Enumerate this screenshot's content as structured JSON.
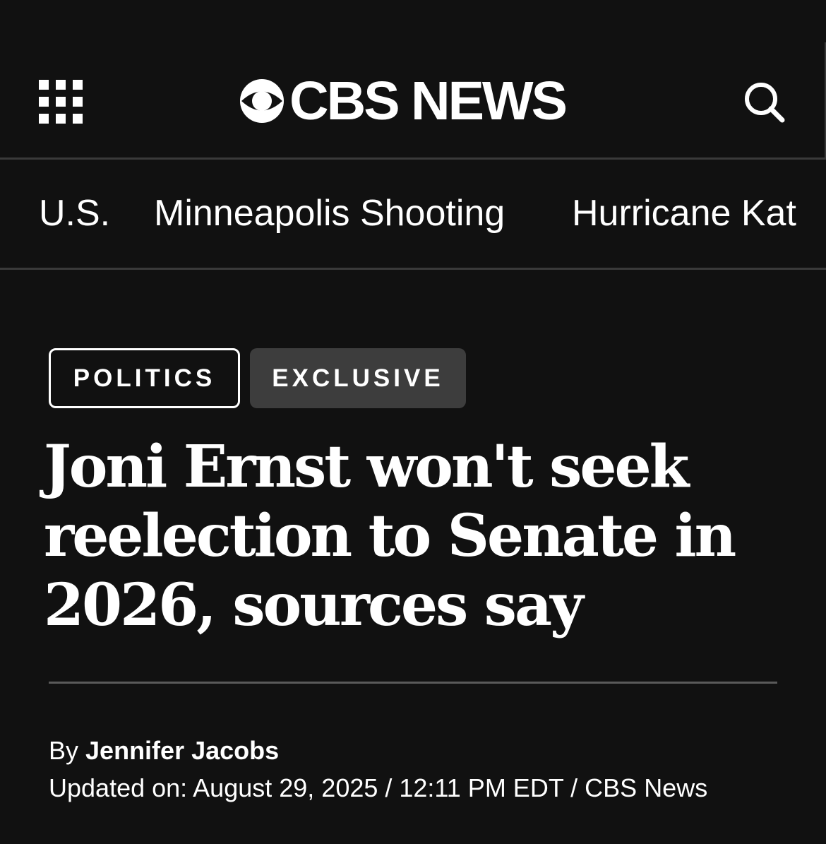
{
  "header": {
    "logo_text": "CBS NEWS",
    "menu_icon": "grid-menu-icon",
    "logo_icon": "cbs-eye-icon",
    "search_icon": "search-icon"
  },
  "nav": {
    "items": [
      {
        "label": "U.S."
      },
      {
        "label": "Minneapolis Shooting"
      },
      {
        "label": "Hurricane Kat"
      }
    ]
  },
  "article": {
    "tags": [
      {
        "label": "POLITICS"
      },
      {
        "label": "EXCLUSIVE"
      }
    ],
    "headline": "Joni Ernst won't seek reelection to Senate in 2026, sources say",
    "byline_prefix": "By",
    "author": "Jennifer Jacobs",
    "updated": "Updated on: August 29, 2025 / 12:11 PM EDT / CBS News"
  },
  "colors": {
    "background": "#111111",
    "divider": "#3a3a3a",
    "exclusive_tag_bg": "#3d3d3d",
    "text": "#ffffff"
  }
}
